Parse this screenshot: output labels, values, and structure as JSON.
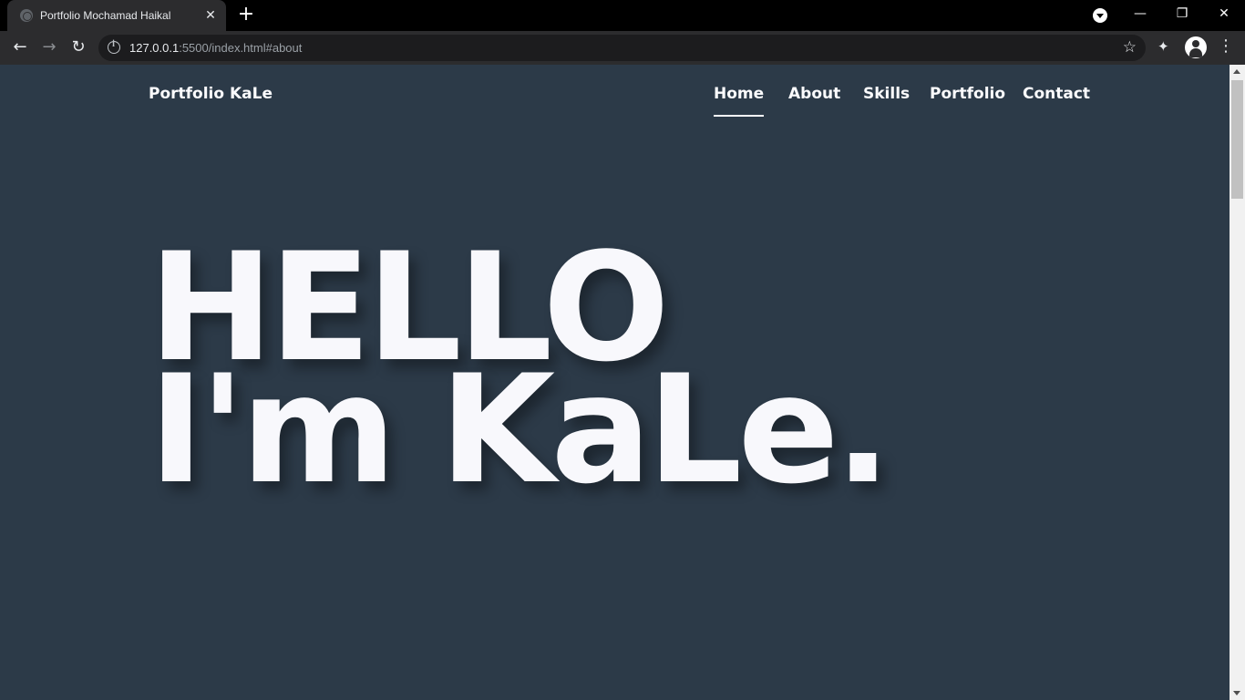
{
  "browser": {
    "tab_title": "Portfolio Mochamad Haikal",
    "tab_close": "✕",
    "new_tab": "+",
    "window_controls": {
      "minimize": "—",
      "restore": "❐",
      "close": "✕"
    },
    "nav": {
      "back": "←",
      "forward": "→",
      "reload": "↻"
    },
    "url_host": "127.0.0.1",
    "url_rest": ":5500/index.html#about",
    "star": "☆",
    "extensions": "✦",
    "menu": "⋮"
  },
  "page": {
    "brand": "Portfolio KaLe",
    "nav_items": [
      {
        "label": "Home",
        "active": true
      },
      {
        "label": "About",
        "active": false
      },
      {
        "label": "Skills",
        "active": false
      },
      {
        "label": "Portfolio",
        "active": false
      },
      {
        "label": "Contact",
        "active": false
      }
    ],
    "hero_line1": "HELLO",
    "hero_line2": "I'm KaLe."
  },
  "colors": {
    "page_bg": "#2c3a48",
    "text": "#fbfbfd",
    "browser_chrome": "#2c2c2e"
  },
  "icons": [
    "favicon-icon",
    "close-icon",
    "plus-icon",
    "tab-search-icon",
    "back-icon",
    "forward-icon",
    "reload-icon",
    "info-icon",
    "star-icon",
    "extensions-icon",
    "profile-icon",
    "menu-icon"
  ]
}
